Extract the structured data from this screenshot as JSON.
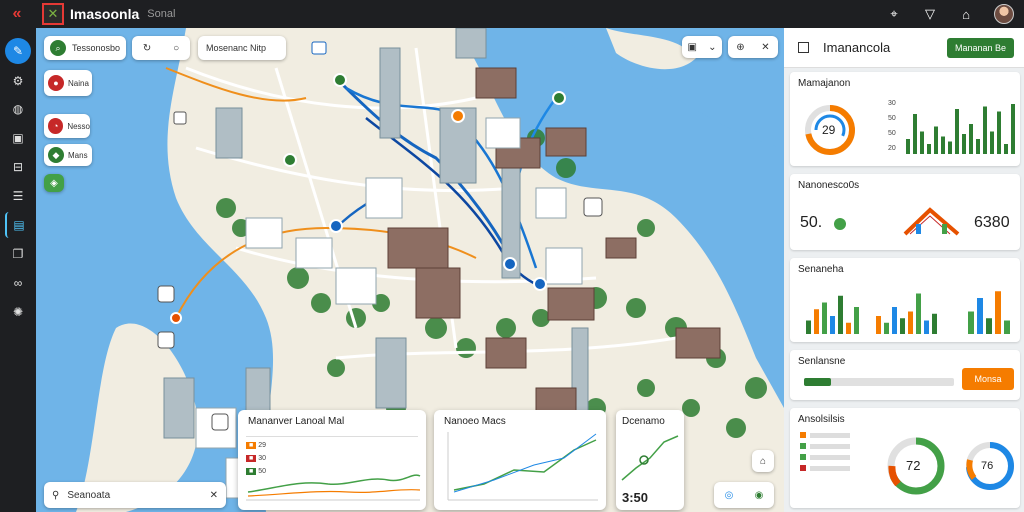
{
  "app": {
    "title": "Imasoonla",
    "subtitle": "Sonal"
  },
  "topbar": {
    "back_icon": "back-arrow-icon",
    "icons": [
      "pin-icon",
      "filter-icon",
      "home-icon"
    ]
  },
  "rail": {
    "items": [
      "menu-icon",
      "settings-icon",
      "pin-icon",
      "camera-icon",
      "inbox-icon",
      "document-icon",
      "monitor-icon",
      "bookmark-icon",
      "link-icon",
      "globe-icon"
    ]
  },
  "map": {
    "search": {
      "label": "Tessonosbo"
    },
    "filter": {
      "label": "Mosenanc Nitp"
    },
    "chips": [
      {
        "label": "Naina"
      },
      {
        "label": "Nesso"
      },
      {
        "label": "Mans"
      }
    ],
    "bottom_search": {
      "label": "Seanoata"
    },
    "card1": {
      "title": "Mananver Lanoal Mal",
      "rows": [
        "29",
        "30",
        "50"
      ]
    },
    "card2": {
      "title": "Nanoeo Macs"
    },
    "card3": {
      "title": "Dcenamo",
      "value": "3:50"
    }
  },
  "panel": {
    "header": {
      "title": "Imanancola",
      "button": "Mananan Be"
    },
    "card1": {
      "title": "Mamajanon",
      "gauge": "29",
      "gauge_percent": 72,
      "bars": [
        30,
        80,
        45,
        20,
        55,
        35,
        25,
        90,
        40,
        60,
        30,
        95,
        45,
        85,
        20,
        100
      ],
      "axis": [
        "30",
        "50",
        "50",
        "20"
      ]
    },
    "card2": {
      "title": "Nanonesco0s",
      "left_value": "50.",
      "right_value": "6380"
    },
    "card3": {
      "title": "Senaneha",
      "bars1": [
        30,
        55,
        70,
        40,
        85,
        25,
        60
      ],
      "bars2": [
        40,
        25,
        60,
        35,
        50,
        90,
        30,
        45
      ],
      "bars3": [
        50,
        80,
        35,
        95,
        30
      ]
    },
    "card4": {
      "title": "Senlansne",
      "progress_percent": 18,
      "button": "Monsa"
    },
    "card5": {
      "title": "Ansolsilsis",
      "gauge1": "72",
      "gauge1_percent": 68,
      "gauge2": "76",
      "gauge2_percent": 74
    }
  },
  "colors": {
    "accent_green": "#2e7d32",
    "accent_orange": "#f57c00",
    "accent_blue": "#1e88e5",
    "topbar_bg": "#1e1f22"
  }
}
